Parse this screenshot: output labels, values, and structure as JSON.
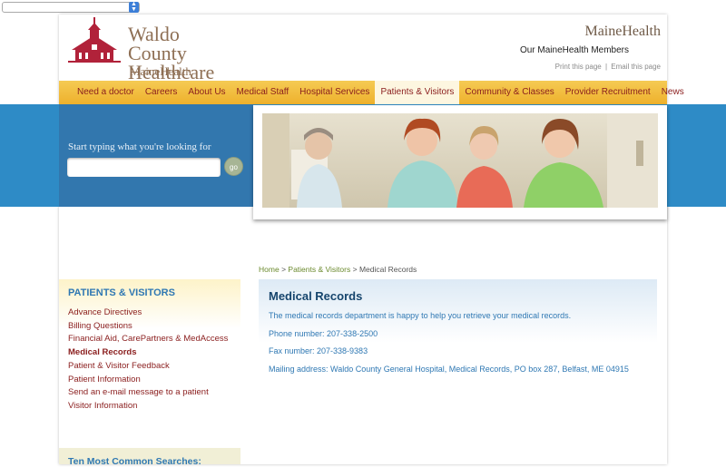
{
  "header": {
    "logo_name": "Waldo County Healthcare",
    "logo_line1": "Waldo County",
    "logo_line2": "Healthcare",
    "logo_sub": "MaineHealth",
    "brand": "MaineHealth",
    "members_link": "Our MaineHealth Members",
    "print_link": "Print this page",
    "separator": "|",
    "email_link": "Email this page"
  },
  "nav": {
    "items": [
      {
        "label": "Need a doctor"
      },
      {
        "label": "Careers"
      },
      {
        "label": "About Us"
      },
      {
        "label": "Medical Staff"
      },
      {
        "label": "Hospital Services"
      },
      {
        "label": "Patients & Visitors"
      },
      {
        "label": "Community & Classes"
      },
      {
        "label": "Provider Recruitment"
      },
      {
        "label": "News"
      }
    ],
    "active_index": 5
  },
  "search": {
    "label": "Start typing what you're looking for",
    "placeholder": "",
    "button": "go"
  },
  "sidebar": {
    "heading": "PATIENTS & VISITORS",
    "items": [
      {
        "label": "Advance Directives"
      },
      {
        "label": "Billing Questions"
      },
      {
        "label": "Financial Aid, CarePartners & MedAccess"
      },
      {
        "label": "Medical Records"
      },
      {
        "label": "Patient & Visitor Feedback"
      },
      {
        "label": "Patient Information"
      },
      {
        "label": "Send an e-mail message to a patient"
      },
      {
        "label": "Visitor Information"
      }
    ],
    "current_index": 3,
    "searches_heading": "Ten Most Common Searches:"
  },
  "breadcrumb": {
    "home": "Home",
    "sep": ">",
    "section": "Patients & Visitors",
    "current": "Medical Records"
  },
  "content": {
    "title": "Medical Records",
    "intro": "The medical records department is happy to help you retrieve your medical records.",
    "phone": "Phone number: 207-338-2500",
    "fax": "Fax number: 207-338-9383",
    "mailing": "Mailing address: Waldo County General Hospital, Medical Records, PO box 287, Belfast, ME 04915"
  },
  "colors": {
    "nav_bg": "#f2bd3e",
    "nav_text": "#8a1d1d",
    "band_blue": "#2e8bc6",
    "heading_blue": "#2f78b3",
    "logo_red": "#b1223a",
    "logo_brown": "#8e6f54"
  }
}
